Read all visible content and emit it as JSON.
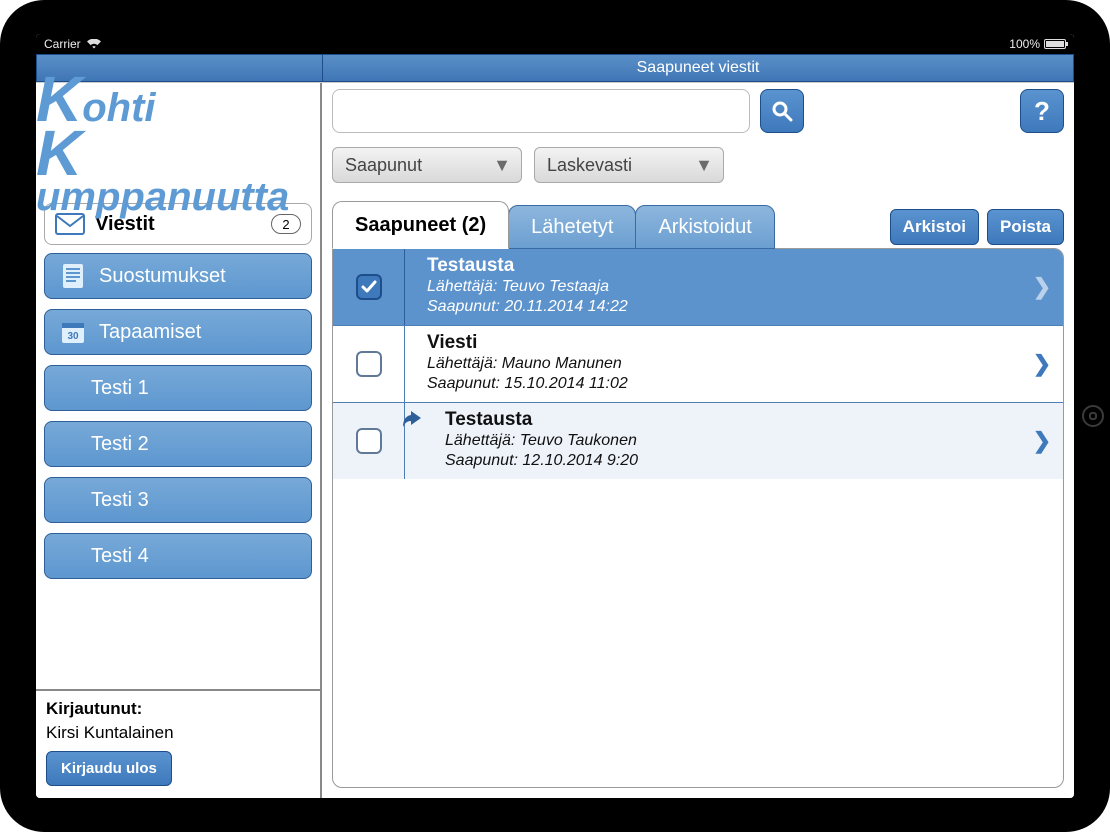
{
  "statusbar": {
    "carrier": "Carrier",
    "battery": "100%"
  },
  "titlebar": {
    "title": "Saapuneet viestit"
  },
  "logo": {
    "line1_big": "K",
    "line1_rest": "ohti",
    "line2_big": "K",
    "line2_rest": "umppanuutta"
  },
  "sidebar": {
    "messages": {
      "label": "Viestit",
      "badge": "2"
    },
    "items": [
      {
        "label": "Suostumukset"
      },
      {
        "label": "Tapaamiset"
      },
      {
        "label": "Testi 1"
      },
      {
        "label": "Testi 2"
      },
      {
        "label": "Testi 3"
      },
      {
        "label": "Testi 4"
      }
    ],
    "footer": {
      "logged_in_label": "Kirjautunut:",
      "user": "Kirsi Kuntalainen",
      "logout": "Kirjaudu ulos"
    }
  },
  "main": {
    "search_placeholder": "",
    "dropdowns": {
      "filter": "Saapunut",
      "sort": "Laskevasti"
    },
    "tabs": {
      "inbox": "Saapuneet (2)",
      "sent": "Lähetetyt",
      "archived": "Arkistoidut"
    },
    "actions": {
      "archive": "Arkistoi",
      "delete": "Poista"
    },
    "messages": [
      {
        "title": "Testausta",
        "sender": "Lähettäjä: Teuvo Testaaja",
        "arrived": "Saapunut: 20.11.2014 14:22",
        "selected": true,
        "checked": true,
        "reply": false
      },
      {
        "title": "Viesti",
        "sender": "Lähettäjä: Mauno Manunen",
        "arrived": "Saapunut: 15.10.2014 11:02",
        "selected": false,
        "checked": false,
        "reply": false
      },
      {
        "title": "Testausta",
        "sender": "Lähettäjä: Teuvo Taukonen",
        "arrived": "Saapunut: 12.10.2014 9:20",
        "selected": false,
        "checked": false,
        "reply": true
      }
    ]
  }
}
